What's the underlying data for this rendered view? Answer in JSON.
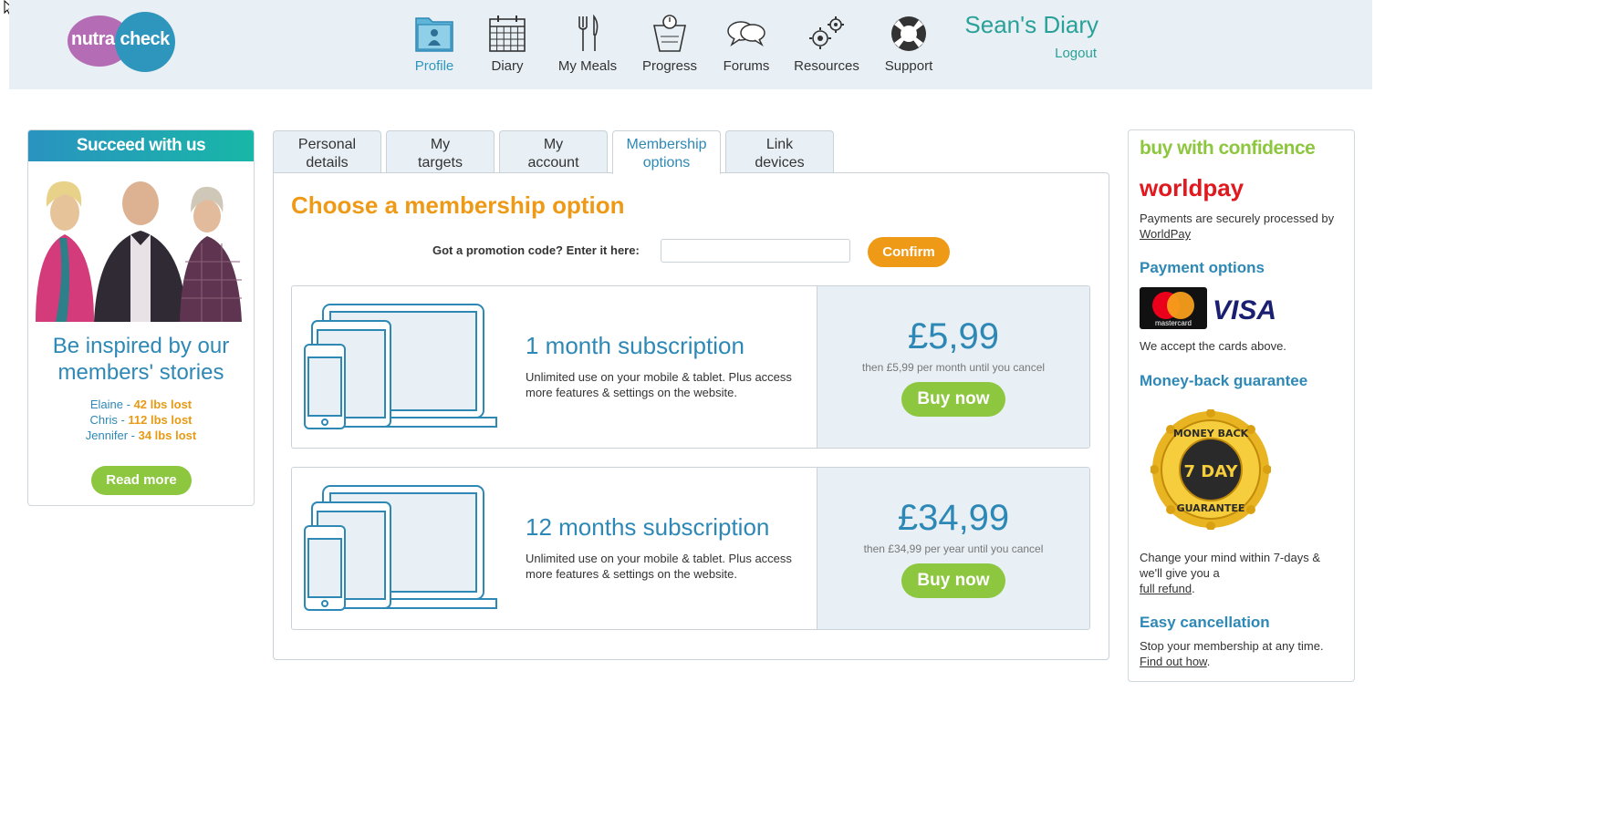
{
  "header": {
    "logo": {
      "part1": "nutra",
      "part2": "check"
    },
    "nav": [
      {
        "label": "Profile",
        "icon": "profile-folder-icon",
        "active": true
      },
      {
        "label": "Diary",
        "icon": "calendar-icon",
        "active": false
      },
      {
        "label": "My Meals",
        "icon": "fork-knife-icon",
        "active": false
      },
      {
        "label": "Progress",
        "icon": "scale-icon",
        "active": false
      },
      {
        "label": "Forums",
        "icon": "chat-bubbles-icon",
        "active": false
      },
      {
        "label": "Resources",
        "icon": "gears-icon",
        "active": false
      },
      {
        "label": "Support",
        "icon": "lifebuoy-icon",
        "active": false
      }
    ],
    "user_title": "Sean's Diary",
    "logout": "Logout"
  },
  "left_card": {
    "header": "Succeed with us",
    "inspire": "Be inspired by our members' stories",
    "stories": [
      {
        "name": "Elaine",
        "result": "42 lbs lost"
      },
      {
        "name": "Chris",
        "result": "112 lbs lost"
      },
      {
        "name": "Jennifer",
        "result": "34 lbs lost"
      }
    ],
    "read_more": "Read more"
  },
  "tabs": [
    {
      "line1": "Personal",
      "line2": "details",
      "active": false
    },
    {
      "line1": "My",
      "line2": "targets",
      "active": false
    },
    {
      "line1": "My",
      "line2": "account",
      "active": false
    },
    {
      "line1": "Membership",
      "line2": "options",
      "active": true
    },
    {
      "line1": "Link",
      "line2": "devices",
      "active": false
    }
  ],
  "membership": {
    "title": "Choose a membership option",
    "promo_label": "Got a promotion code? Enter it here:",
    "promo_value": "",
    "confirm": "Confirm",
    "plans": [
      {
        "title": "1 month subscription",
        "description": "Unlimited use on your mobile & tablet. Plus access more features & settings on the website.",
        "price": "£5,99",
        "then": "then £5,99 per month until you cancel",
        "buy": "Buy now"
      },
      {
        "title": "12 months subscription",
        "description": "Unlimited use on your mobile & tablet. Plus access more features & settings on the website.",
        "price": "£34,99",
        "then": "then £34,99 per year until you cancel",
        "buy": "Buy now"
      }
    ]
  },
  "right_card": {
    "title": "buy with confidence",
    "worldpay": "worldpay",
    "secure_text": "Payments are securely processed by",
    "secure_link": "WorldPay",
    "payment_heading": "Payment options",
    "mastercard_label": "mastercard",
    "visa_label": "VISA",
    "accept_text": "We accept the cards above.",
    "moneyback_heading": "Money-back guarantee",
    "badge": {
      "top": "MONEY BACK",
      "middle": "7 DAY",
      "bottom": "GUARANTEE"
    },
    "change_text": "Change your mind within 7-days & we'll give you a",
    "change_link": "full refund",
    "cancel_heading": "Easy cancellation",
    "cancel_text": "Stop your membership at any time.",
    "cancel_link": "Find out how"
  },
  "colors": {
    "accent_blue": "#2e88b6",
    "accent_orange": "#ef9a17",
    "accent_green": "#8dc63f",
    "teal": "#2aa198",
    "worldpay_red": "#e1181e",
    "header_bg": "#e8f0f6"
  }
}
